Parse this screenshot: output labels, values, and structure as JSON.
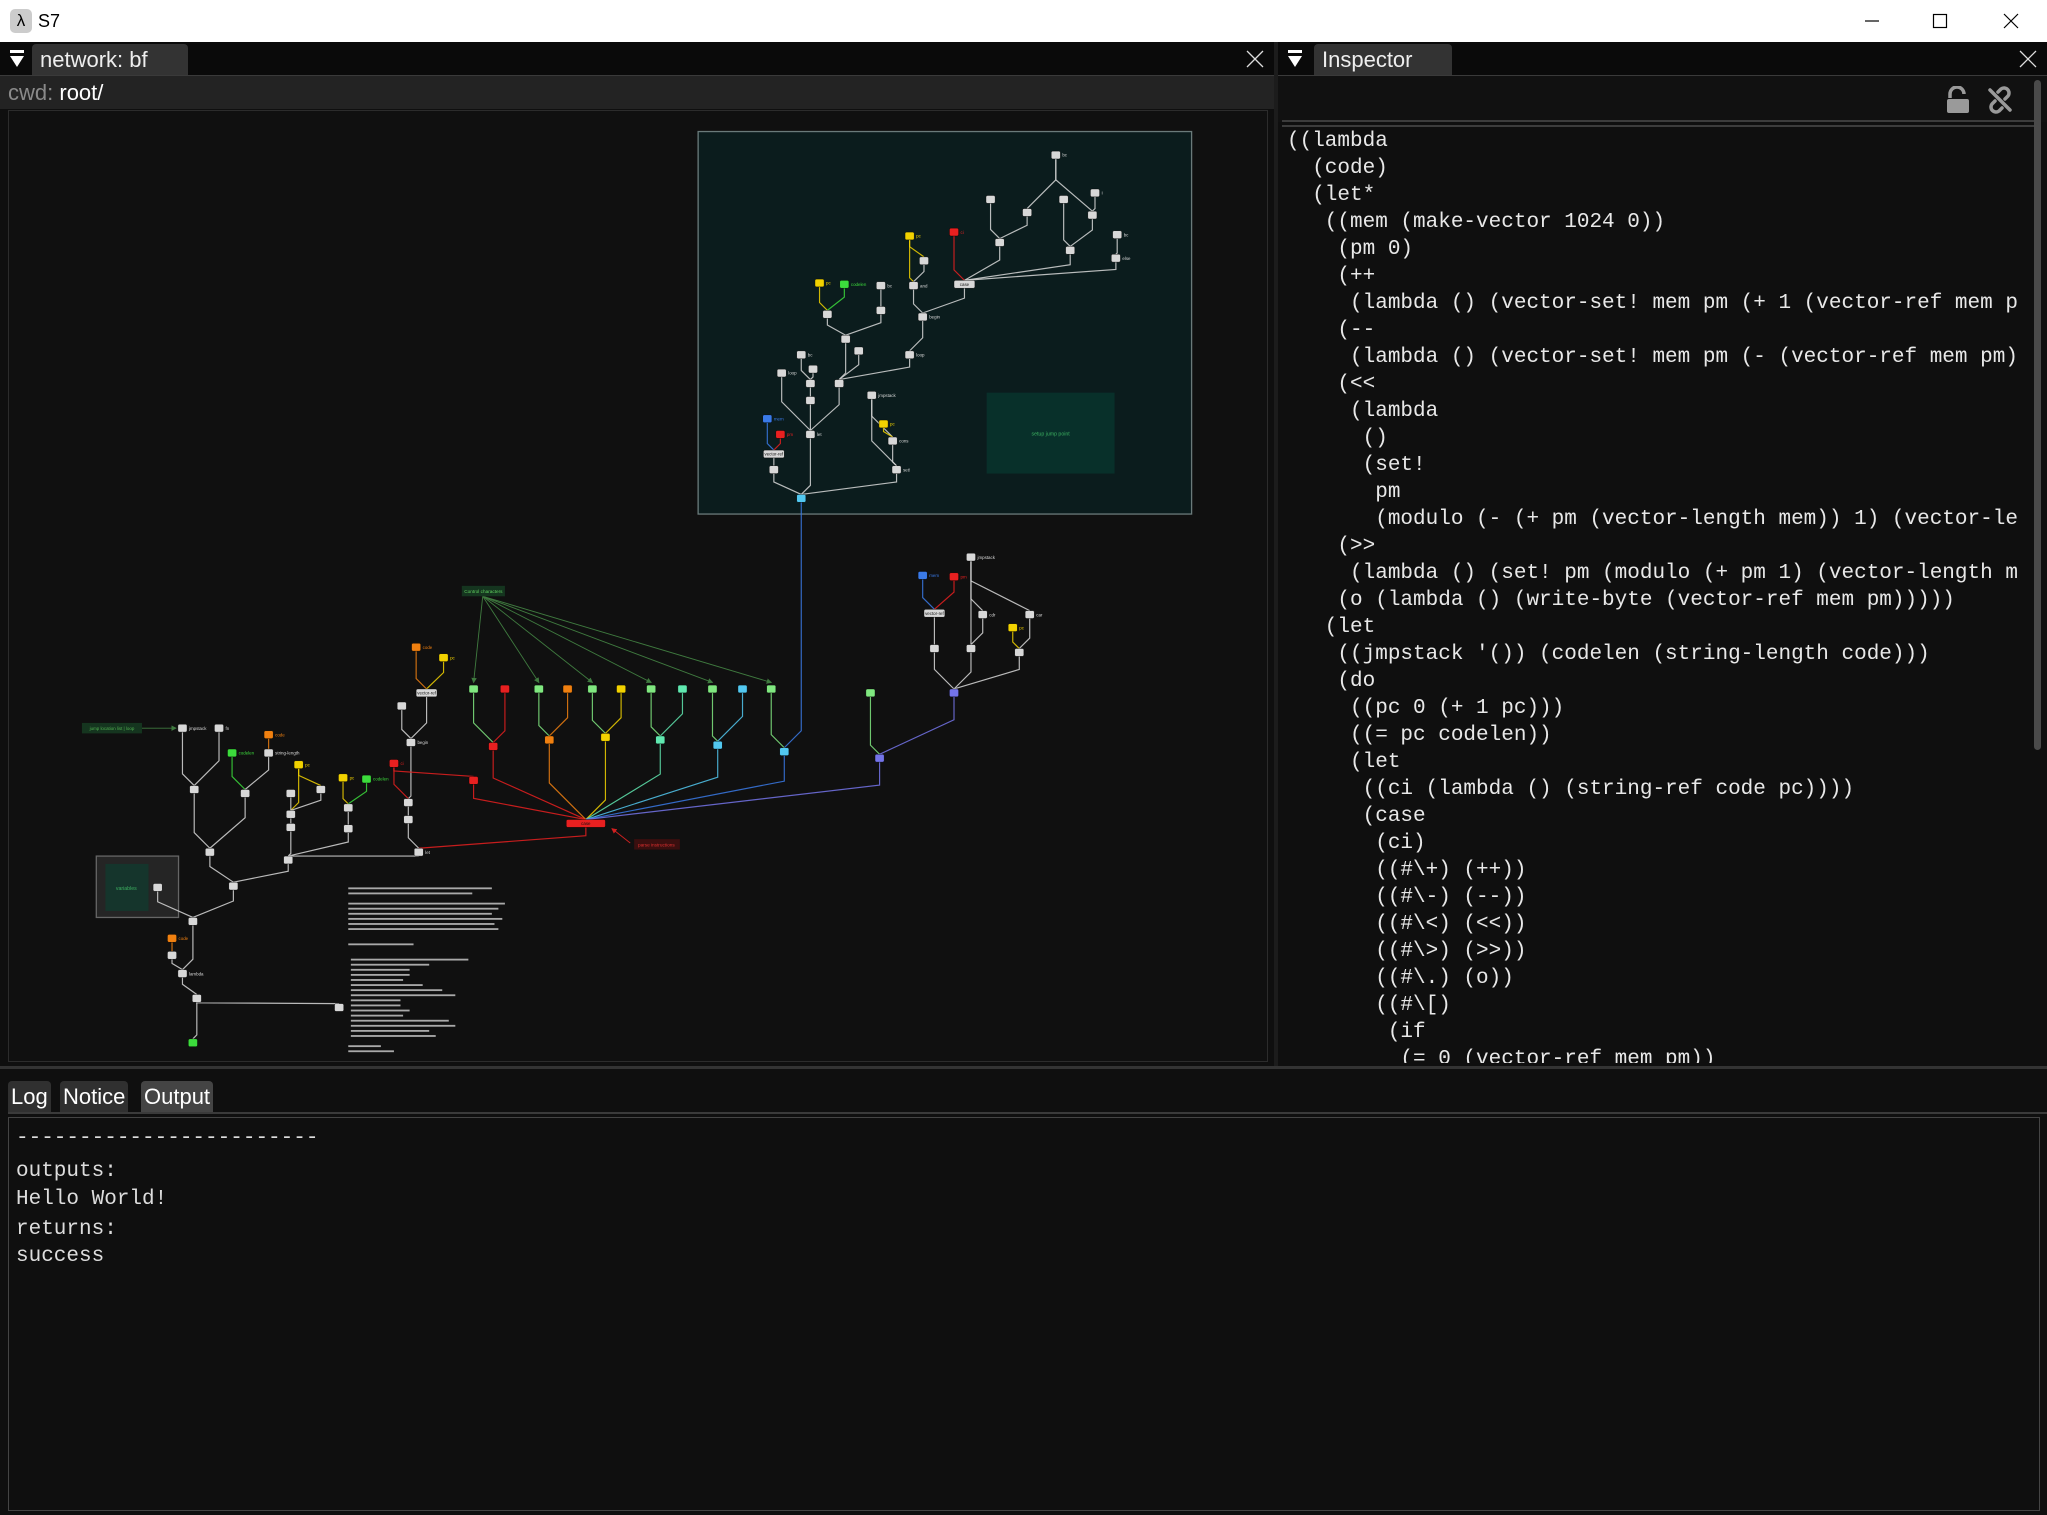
{
  "window": {
    "icon": "λ",
    "title": "S7",
    "controls": [
      "minimize-icon",
      "maximize-icon",
      "close-icon"
    ]
  },
  "network_panel": {
    "tab_label": "network: bf",
    "cwd_label": "cwd:",
    "cwd_value": "root/",
    "canvas": {
      "frame_label": "setup jump point",
      "group_label": "variables",
      "annotations": {
        "control": "Control characters",
        "parse": "parse instructions",
        "jump": "jump location list | loop"
      },
      "node_labels": {
        "A": "bc",
        "E": "I",
        "I": "bc",
        "J": "else",
        "K": "ci",
        "L": "case",
        "M": "pc",
        "O": "and",
        "P": "begin",
        "Q": "loop",
        "R": "pc",
        "S": "codelen",
        "T": "bc",
        "Z": "bc",
        "AB": "loop",
        "AE": "let",
        "AF": "mem",
        "AG": "pm",
        "AH": "vector-ref",
        "AJ": "jmpstack",
        "AK": "pc",
        "AL": "cons",
        "AM": "set!",
        "m1": "jmpstack",
        "m2": "mem",
        "m3": "pm",
        "m4": "vector-ref",
        "m5": "cdr",
        "m6": "car",
        "m7": "pc",
        "l1": "jmpstack",
        "l2": "fn",
        "l3": "code",
        "l4": "codelen",
        "l5": "string-length",
        "l6": "pc",
        "l9": "pc",
        "l10": "codelen",
        "l11": "ci",
        "l12": "code",
        "l13": "pc",
        "l14": "vector-ref",
        "l16": "begin",
        "lz": "let",
        "lc": "code",
        "le": "lambda",
        "case": "case"
      },
      "colors": {
        "white": "#d8d8d8",
        "yellow": "#f2d200",
        "green": "#3cdc3c",
        "orange": "#f08010",
        "red": "#e82020",
        "blue": "#3a7ae8",
        "lightgreen": "#80e880",
        "cyan": "#52c8f0",
        "purple": "#7474ea",
        "teal": "#60e8b0",
        "frame": "#0b1c1d"
      }
    }
  },
  "inspector": {
    "tab_label": "Inspector",
    "toolbar_icons": [
      "lock-open-icon",
      "unlink-icon"
    ],
    "code_lines": [
      "((lambda",
      "  (code)",
      "  (let*",
      "   ((mem (make-vector 1024 0))",
      "    (pm 0)",
      "    (++",
      "     (lambda () (vector-set! mem pm (+ 1 (vector-ref mem p",
      "    (--",
      "     (lambda () (vector-set! mem pm (- (vector-ref mem pm)",
      "    (<<",
      "     (lambda",
      "      ()",
      "      (set!",
      "       pm",
      "       (modulo (- (+ pm (vector-length mem)) 1) (vector-le",
      "    (>>",
      "     (lambda () (set! pm (modulo (+ pm 1) (vector-length m",
      "    (o (lambda () (write-byte (vector-ref mem pm)))))",
      "   (let",
      "    ((jmpstack '()) (codelen (string-length code)))",
      "    (do",
      "     ((pc 0 (+ 1 pc)))",
      "     ((= pc codelen))",
      "     (let",
      "      ((ci (lambda () (string-ref code pc))))",
      "      (case",
      "       (ci)",
      "       ((#\\+) (++))",
      "       ((#\\-) (--))",
      "       ((#\\<) (<<))",
      "       ((#\\>) (>>))",
      "       ((#\\.) (o))",
      "       ((#\\[)",
      "        (if",
      "         (= 0 (vector-ref mem pm))"
    ]
  },
  "bottom_panel": {
    "tabs": [
      {
        "label": "Log"
      },
      {
        "label": "Notice"
      },
      {
        "label": "Output",
        "active": true
      }
    ],
    "output_lines": [
      "------------------------",
      "outputs:",
      "Hello World!",
      "returns:",
      "success"
    ]
  }
}
